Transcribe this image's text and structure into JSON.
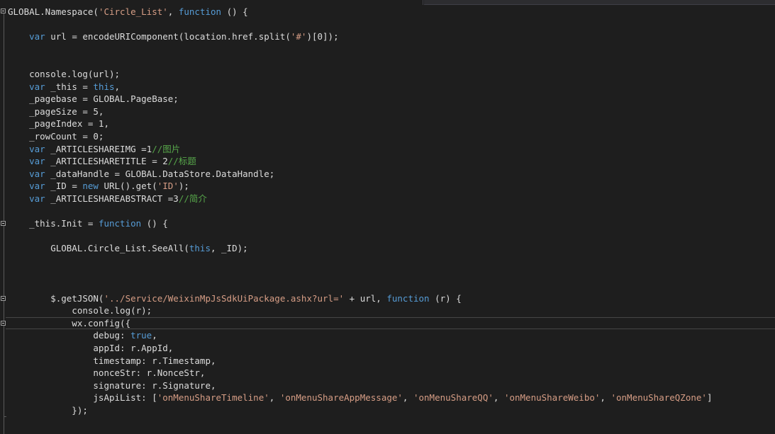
{
  "editor": {
    "lines": [
      [
        {
          "t": "tx",
          "v": "GLOBAL.Namespace("
        },
        {
          "t": "str",
          "v": "'Circle_List'"
        },
        {
          "t": "tx",
          "v": ", "
        },
        {
          "t": "kw",
          "v": "function"
        },
        {
          "t": "tx",
          "v": " () {"
        }
      ],
      [],
      [
        {
          "t": "tx",
          "v": "    "
        },
        {
          "t": "kw",
          "v": "var"
        },
        {
          "t": "tx",
          "v": " url = encodeURIComponent(location.href.split("
        },
        {
          "t": "str",
          "v": "'#'"
        },
        {
          "t": "tx",
          "v": ")[0]);"
        }
      ],
      [],
      [],
      [
        {
          "t": "tx",
          "v": "    console.log(url);"
        }
      ],
      [
        {
          "t": "tx",
          "v": "    "
        },
        {
          "t": "kw",
          "v": "var"
        },
        {
          "t": "tx",
          "v": " _this = "
        },
        {
          "t": "kw",
          "v": "this"
        },
        {
          "t": "tx",
          "v": ","
        }
      ],
      [
        {
          "t": "tx",
          "v": "    _pagebase = GLOBAL.PageBase;"
        }
      ],
      [
        {
          "t": "tx",
          "v": "    _pageSize = 5,"
        }
      ],
      [
        {
          "t": "tx",
          "v": "    _pageIndex = 1,"
        }
      ],
      [
        {
          "t": "tx",
          "v": "    _rowCount = 0;"
        }
      ],
      [
        {
          "t": "tx",
          "v": "    "
        },
        {
          "t": "kw",
          "v": "var"
        },
        {
          "t": "tx",
          "v": " _ARTICLESHAREIMG =1"
        },
        {
          "t": "cm",
          "v": "//图片"
        }
      ],
      [
        {
          "t": "tx",
          "v": "    "
        },
        {
          "t": "kw",
          "v": "var"
        },
        {
          "t": "tx",
          "v": " _ARTICLESHARETITLE = 2"
        },
        {
          "t": "cm",
          "v": "//标题"
        }
      ],
      [
        {
          "t": "tx",
          "v": "    "
        },
        {
          "t": "kw",
          "v": "var"
        },
        {
          "t": "tx",
          "v": " _dataHandle = GLOBAL.DataStore.DataHandle;"
        }
      ],
      [
        {
          "t": "tx",
          "v": "    "
        },
        {
          "t": "kw",
          "v": "var"
        },
        {
          "t": "tx",
          "v": " _ID = "
        },
        {
          "t": "kw",
          "v": "new"
        },
        {
          "t": "tx",
          "v": " URL().get("
        },
        {
          "t": "str",
          "v": "'ID'"
        },
        {
          "t": "tx",
          "v": ");"
        }
      ],
      [
        {
          "t": "tx",
          "v": "    "
        },
        {
          "t": "kw",
          "v": "var"
        },
        {
          "t": "tx",
          "v": " _ARTICLESHAREABSTRACT =3"
        },
        {
          "t": "cm",
          "v": "//简介"
        }
      ],
      [],
      [
        {
          "t": "tx",
          "v": "    _this.Init = "
        },
        {
          "t": "kw",
          "v": "function"
        },
        {
          "t": "tx",
          "v": " () {"
        }
      ],
      [],
      [
        {
          "t": "tx",
          "v": "        GLOBAL.Circle_List.SeeAll("
        },
        {
          "t": "kw",
          "v": "this"
        },
        {
          "t": "tx",
          "v": ", _ID);"
        }
      ],
      [],
      [],
      [],
      [
        {
          "t": "tx",
          "v": "        $.getJSON("
        },
        {
          "t": "str",
          "v": "'../Service/WeixinMpJsSdkUiPackage.ashx?url='"
        },
        {
          "t": "tx",
          "v": " + url, "
        },
        {
          "t": "kw",
          "v": "function"
        },
        {
          "t": "tx",
          "v": " (r) {"
        }
      ],
      [
        {
          "t": "tx",
          "v": "            console.log(r);"
        }
      ],
      [
        {
          "t": "tx",
          "v": "            wx.config({"
        }
      ],
      [
        {
          "t": "tx",
          "v": "                debug: "
        },
        {
          "t": "kw",
          "v": "true"
        },
        {
          "t": "tx",
          "v": ","
        }
      ],
      [
        {
          "t": "tx",
          "v": "                appId: r.AppId,"
        }
      ],
      [
        {
          "t": "tx",
          "v": "                timestamp: r.Timestamp,"
        }
      ],
      [
        {
          "t": "tx",
          "v": "                nonceStr: r.NonceStr,"
        }
      ],
      [
        {
          "t": "tx",
          "v": "                signature: r.Signature,"
        }
      ],
      [
        {
          "t": "tx",
          "v": "                jsApiList: ["
        },
        {
          "t": "str",
          "v": "'onMenuShareTimeline'"
        },
        {
          "t": "tx",
          "v": ", "
        },
        {
          "t": "str",
          "v": "'onMenuShareAppMessage'"
        },
        {
          "t": "tx",
          "v": ", "
        },
        {
          "t": "str",
          "v": "'onMenuShareQQ'"
        },
        {
          "t": "tx",
          "v": ", "
        },
        {
          "t": "str",
          "v": "'onMenuShareWeibo'"
        },
        {
          "t": "tx",
          "v": ", "
        },
        {
          "t": "str",
          "v": "'onMenuShareQZone'"
        },
        {
          "t": "tx",
          "v": "]"
        }
      ],
      [
        {
          "t": "tx",
          "v": "            });"
        }
      ],
      []
    ]
  },
  "colors": {
    "background": "#1e1e1e",
    "keyword": "#569cd6",
    "string": "#d69d85",
    "comment": "#57a64a",
    "text": "#dcdcdc"
  }
}
